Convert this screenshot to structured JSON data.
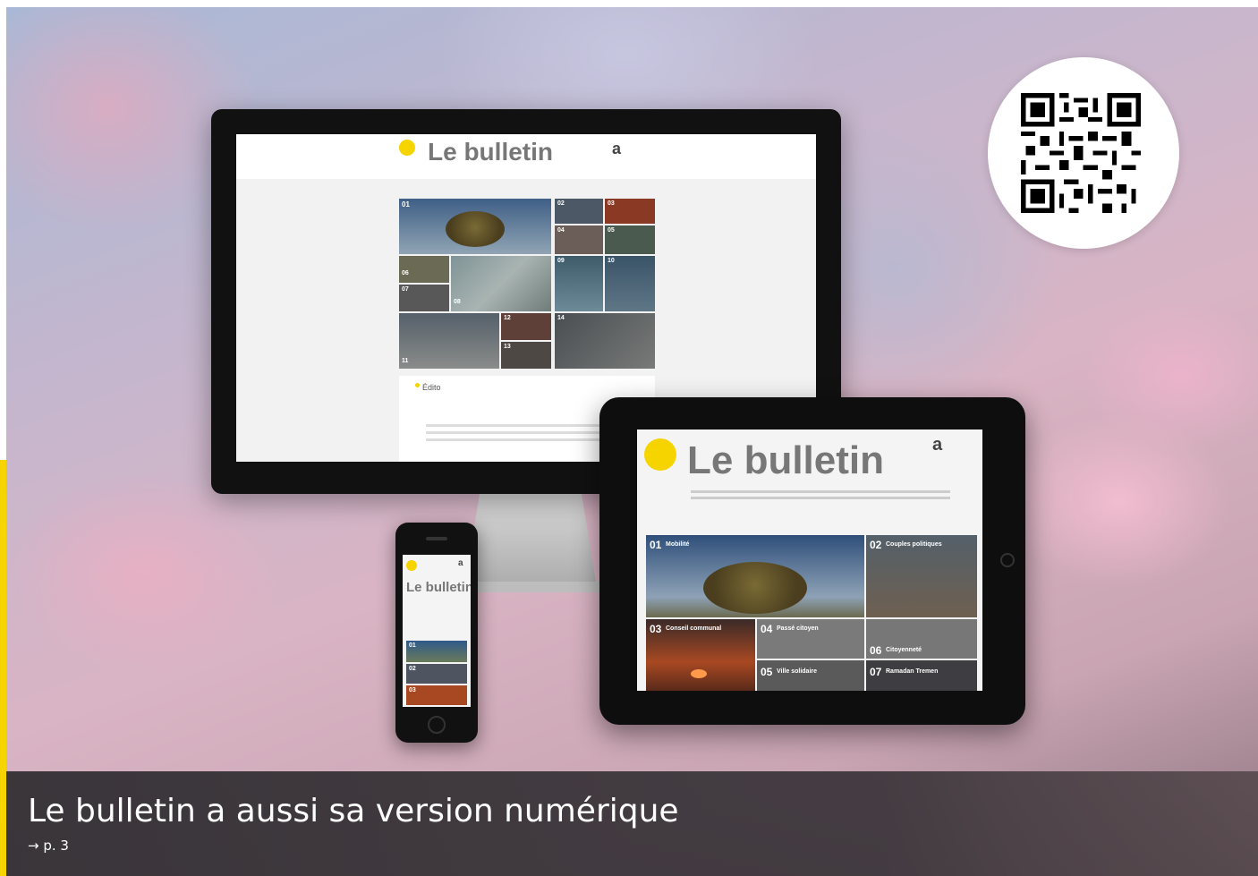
{
  "caption": {
    "title": "Le bulletin a aussi sa version numérique",
    "page_ref": "→ p. 3"
  },
  "mockup": {
    "site_title": "Le bulletin",
    "brand_mark": "a",
    "monitor_tiles": [
      "01",
      "02",
      "03",
      "04",
      "05",
      "06",
      "07",
      "08",
      "09",
      "10",
      "11",
      "12",
      "13",
      "14"
    ],
    "monitor_section": "Édito",
    "tablet_tiles": [
      {
        "num": "01",
        "label": "Mobilité"
      },
      {
        "num": "02",
        "label": "Couples politiques"
      },
      {
        "num": "03",
        "label": "Conseil communal"
      },
      {
        "num": "04",
        "label": "Passé citoyen"
      },
      {
        "num": "05",
        "label": "Ville solidaire"
      },
      {
        "num": "06",
        "label": "Citoyenneté"
      },
      {
        "num": "07",
        "label": "Ramadan Tremen"
      }
    ],
    "phone_tiles": [
      "01",
      "02",
      "03"
    ]
  },
  "colors": {
    "accent": "#f5d400",
    "caption_bg": "#2e2c30"
  },
  "icons": [
    "qr-code-icon",
    "arrow-right-icon"
  ]
}
